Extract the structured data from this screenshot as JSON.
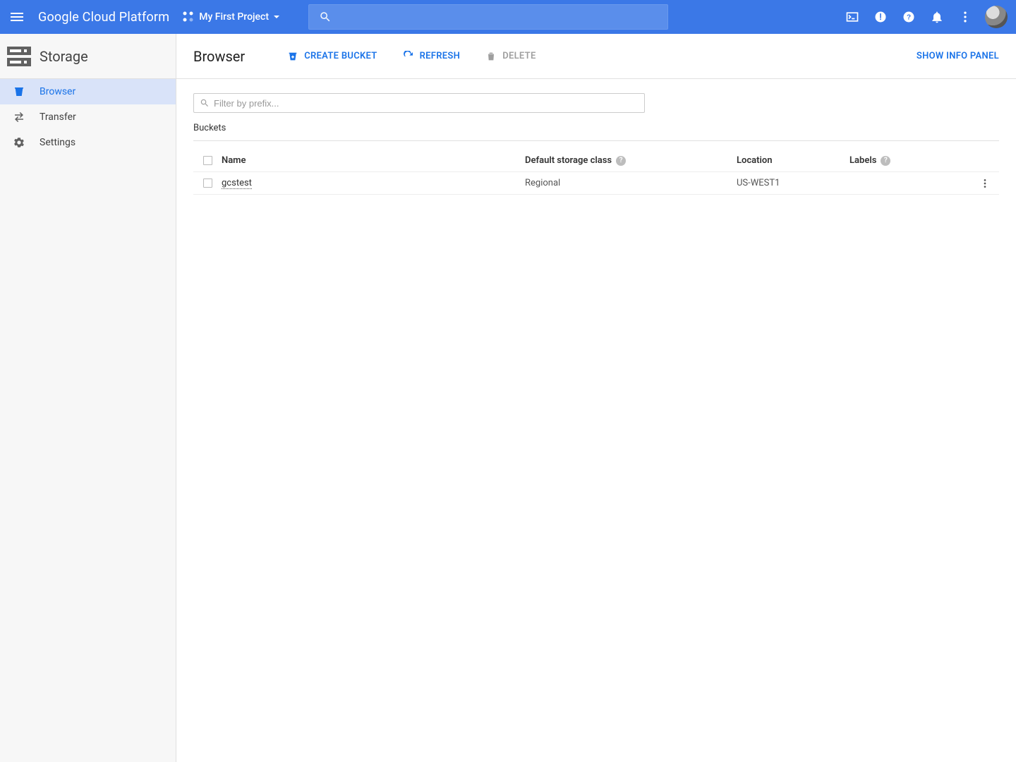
{
  "topbar": {
    "product": "Google Cloud Platform",
    "project": "My First Project",
    "search_placeholder": ""
  },
  "sidebar": {
    "title": "Storage",
    "items": [
      {
        "label": "Browser",
        "active": true
      },
      {
        "label": "Transfer",
        "active": false
      },
      {
        "label": "Settings",
        "active": false
      }
    ]
  },
  "main": {
    "title": "Browser",
    "actions": {
      "create": "CREATE BUCKET",
      "refresh": "REFRESH",
      "delete": "DELETE",
      "info_panel": "SHOW INFO PANEL"
    },
    "filter_placeholder": "Filter by prefix...",
    "section_label": "Buckets",
    "columns": {
      "name": "Name",
      "class": "Default storage class",
      "location": "Location",
      "labels": "Labels"
    },
    "rows": [
      {
        "name": "gcstest",
        "class": "Regional",
        "location": "US-WEST1",
        "labels": ""
      }
    ]
  }
}
